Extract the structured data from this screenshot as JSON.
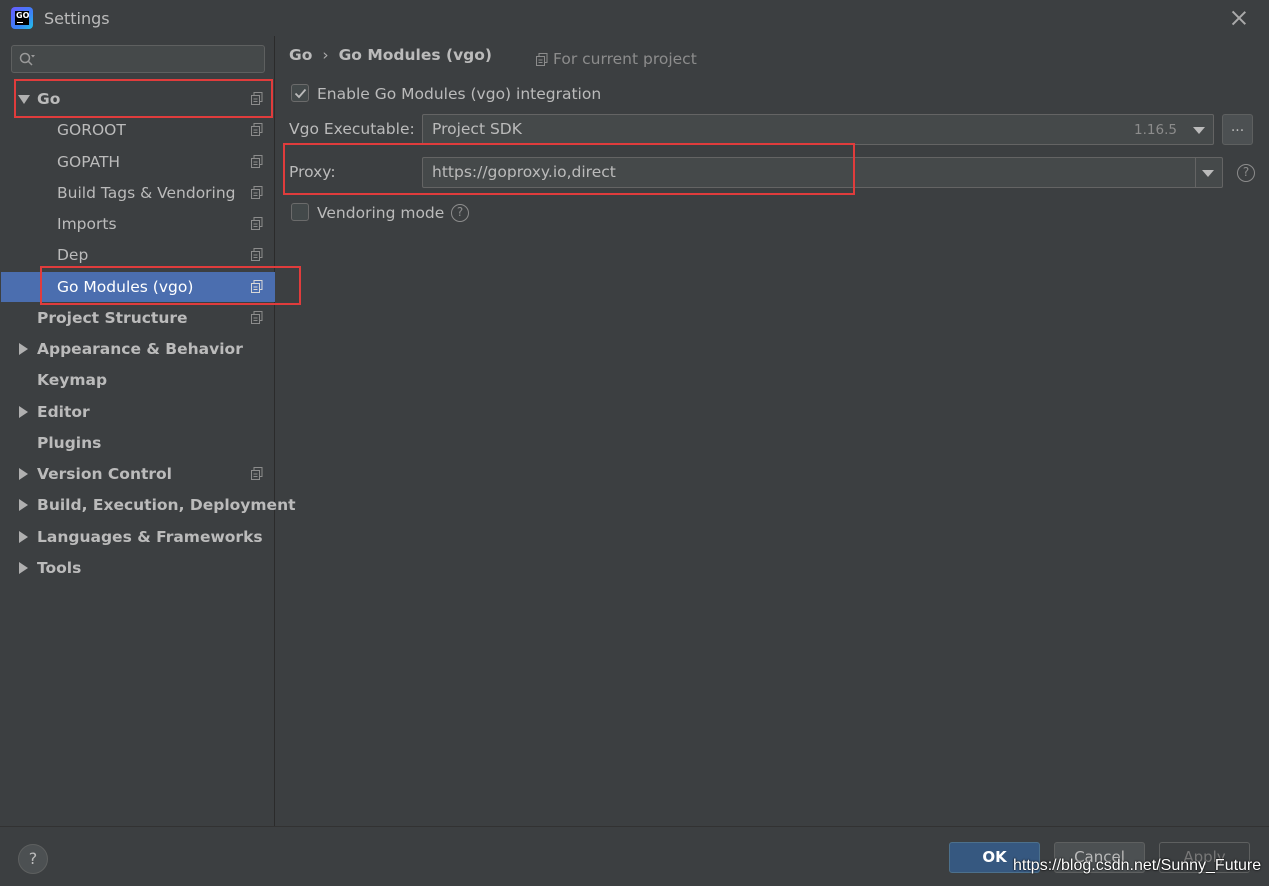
{
  "window": {
    "title": "Settings",
    "logo_text": "GO"
  },
  "sidebar": {
    "search_placeholder": "",
    "items": [
      {
        "label": "Go"
      },
      {
        "label": "GOROOT"
      },
      {
        "label": "GOPATH"
      },
      {
        "label": "Build Tags & Vendoring"
      },
      {
        "label": "Imports"
      },
      {
        "label": "Dep"
      },
      {
        "label": "Go Modules (vgo)"
      },
      {
        "label": "Project Structure"
      },
      {
        "label": "Appearance & Behavior"
      },
      {
        "label": "Keymap"
      },
      {
        "label": "Editor"
      },
      {
        "label": "Plugins"
      },
      {
        "label": "Version Control"
      },
      {
        "label": "Build, Execution, Deployment"
      },
      {
        "label": "Languages & Frameworks"
      },
      {
        "label": "Tools"
      }
    ],
    "selected": "Go Modules (vgo)"
  },
  "main": {
    "breadcrumb": {
      "parent": "Go",
      "separator": "›",
      "current": "Go Modules (vgo)"
    },
    "scope_label": "For current project",
    "enable_modules": {
      "label": "Enable Go Modules (vgo) integration",
      "checked": true
    },
    "vgo_executable": {
      "label": "Vgo Executable:",
      "value": "Project SDK",
      "version": "1.16.5",
      "browse_label": "..."
    },
    "proxy": {
      "label": "Proxy:",
      "value": "https://goproxy.io,direct"
    },
    "vendoring": {
      "label": "Vendoring mode",
      "checked": false
    }
  },
  "footer": {
    "help_label": "?",
    "ok_label": "OK",
    "cancel_label": "Cancel",
    "apply_label": "Apply"
  },
  "watermark": "https://blog.csdn.net/Sunny_Future",
  "colors": {
    "background": "#3c3f41",
    "selection": "#4b6eaf",
    "highlight_box": "#e03c3c",
    "ok_button": "#365880"
  }
}
